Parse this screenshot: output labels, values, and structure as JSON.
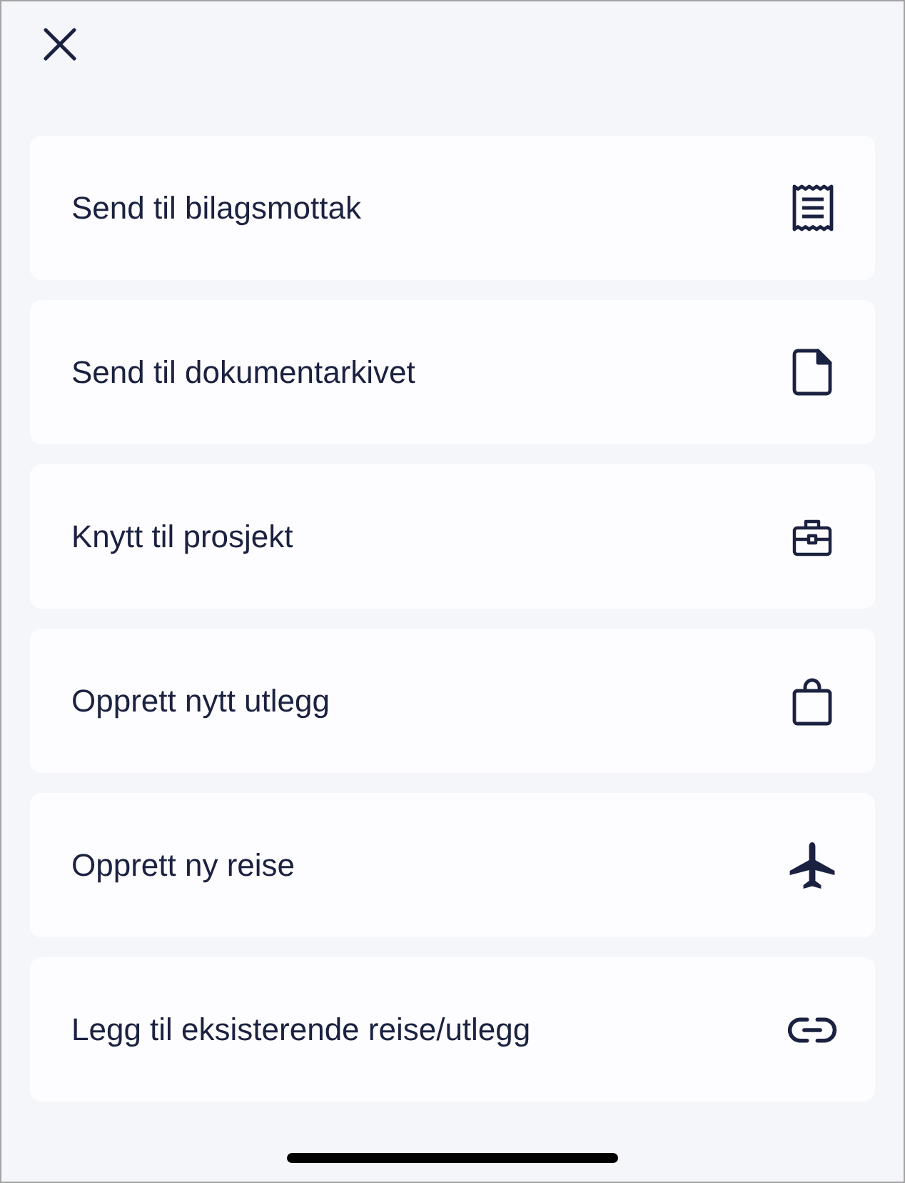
{
  "menu": {
    "items": [
      {
        "label": "Send til bilagsmottak",
        "kind": "receipt"
      },
      {
        "label": "Send til dokumentarkivet",
        "kind": "document"
      },
      {
        "label": "Knytt til prosjekt",
        "kind": "briefcase"
      },
      {
        "label": "Opprett nytt utlegg",
        "kind": "bag"
      },
      {
        "label": "Opprett ny reise",
        "kind": "plane"
      },
      {
        "label": "Legg til eksisterende reise/utlegg",
        "kind": "link"
      }
    ]
  }
}
